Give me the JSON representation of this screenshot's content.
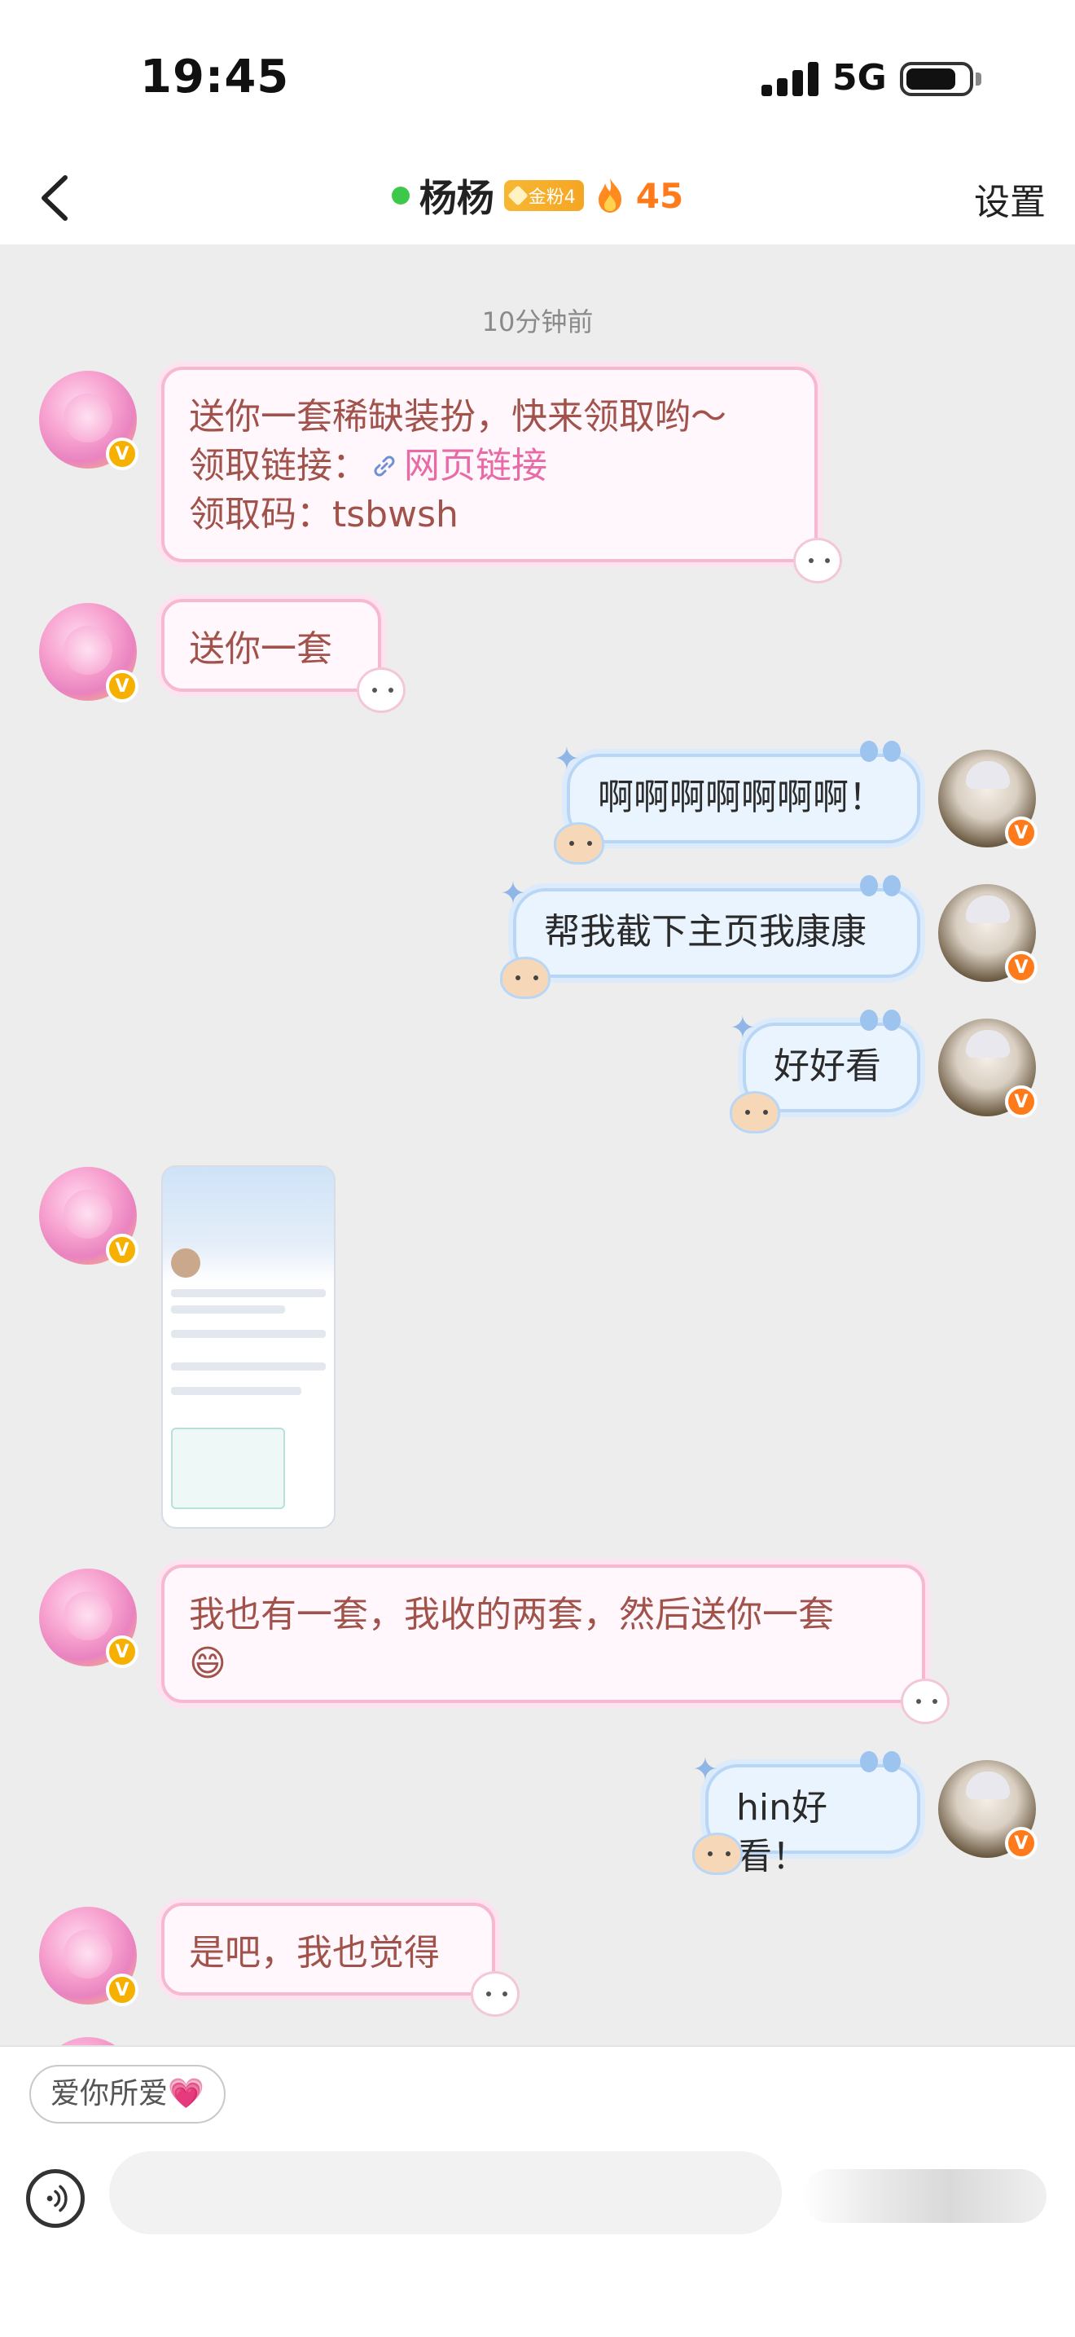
{
  "status_bar": {
    "time": "19:45",
    "network": "5G"
  },
  "nav": {
    "title": "杨杨",
    "badge": "金粉4",
    "fire_count": "45",
    "settings": "设置"
  },
  "chat": {
    "timestamp": "10分钟前",
    "messages": [
      {
        "side": "in",
        "lines": [
          "送你一套稀缺装扮，快来领取哟～",
          "领取链接：",
          "领取码：tsbwsh"
        ],
        "link_text": "网页链接"
      },
      {
        "side": "in",
        "text": "送你一套"
      },
      {
        "side": "out",
        "text": "啊啊啊啊啊啊啊！"
      },
      {
        "side": "out",
        "text": "帮我截下主页我康康"
      },
      {
        "side": "out",
        "text": "好好看"
      },
      {
        "side": "in",
        "type": "image"
      },
      {
        "side": "in",
        "text": "我也有一套，我收的两套，然后送你一套",
        "emoji": "😄"
      },
      {
        "side": "out",
        "text": "hin好看！"
      },
      {
        "side": "in",
        "text": "是吧，我也觉得"
      }
    ]
  },
  "bottom": {
    "quick_reply": "爱你所爱",
    "quick_reply_emoji": "💗",
    "input_placeholder": ""
  },
  "colors": {
    "incoming_text": "#a0524b",
    "incoming_border": "#f6b9d2",
    "outgoing_border": "#b9d7f5",
    "link": "#e86aa6",
    "fire": "#ff7a1a",
    "online": "#3ec84a"
  }
}
